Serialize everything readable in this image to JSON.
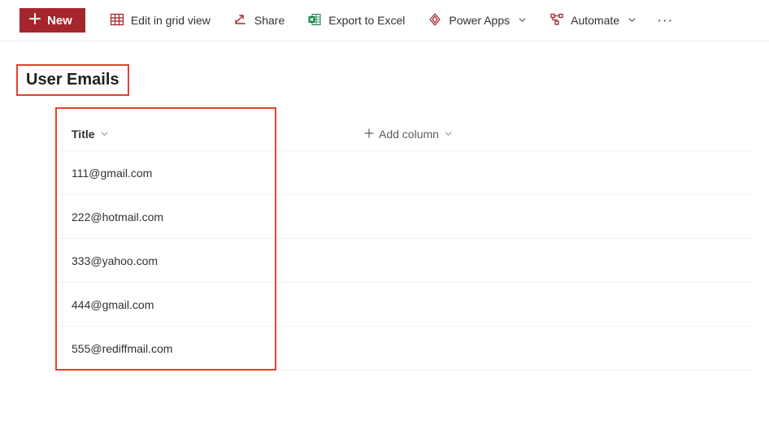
{
  "toolbar": {
    "new_label": "New",
    "edit_grid_label": "Edit in grid view",
    "share_label": "Share",
    "export_label": "Export to Excel",
    "powerapps_label": "Power Apps",
    "automate_label": "Automate"
  },
  "list": {
    "title": "User Emails",
    "columns": {
      "title_label": "Title",
      "add_column_label": "Add column"
    },
    "rows": [
      {
        "title": "111@gmail.com"
      },
      {
        "title": "222@hotmail.com"
      },
      {
        "title": "333@yahoo.com"
      },
      {
        "title": "444@gmail.com"
      },
      {
        "title": "555@rediffmail.com"
      }
    ]
  },
  "colors": {
    "primary_cmd": "#a4262c",
    "icon_red": "#a4262c",
    "icon_green": "#107c41",
    "annotation": "#e1432e"
  }
}
